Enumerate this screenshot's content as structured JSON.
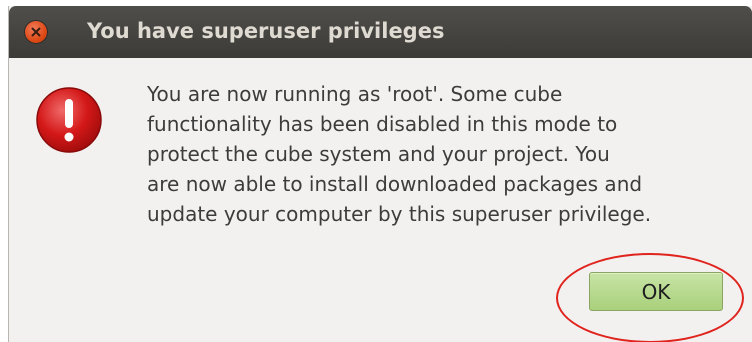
{
  "dialog": {
    "title": "You have superuser privileges",
    "message": "You are now running as 'root'. Some cube\nfunctionality has been disabled in this mode to\nprotect the cube system and your project. You\nare now able to install downloaded packages and\nupdate your computer by this superuser privilege.",
    "ok_label": "OK",
    "close_icon": "close-icon",
    "alert_icon": "error-icon"
  },
  "colors": {
    "titlebar": "#3c3b37",
    "title_text": "#dfdbd2",
    "close_button": "#df4a16",
    "alert_icon": "#d41818",
    "ok_button": "#b4d88c",
    "highlight_circle": "#e0231d"
  }
}
